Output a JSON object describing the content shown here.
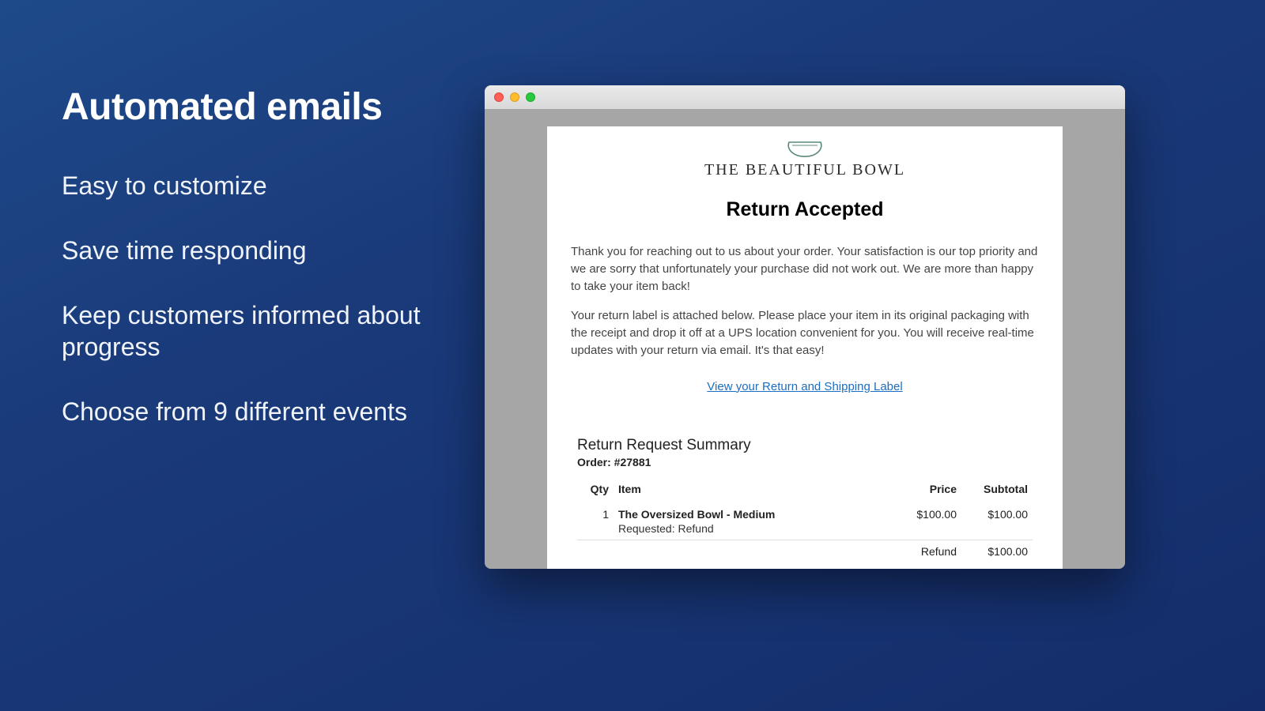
{
  "marketing": {
    "heading": "Automated emails",
    "bullets": [
      "Easy to customize",
      "Save time responding",
      "Keep customers informed about progress",
      "Choose from 9 different events"
    ]
  },
  "email": {
    "brand_name": "THE BEAUTIFUL BOWL",
    "title": "Return Accepted",
    "paragraph1": "Thank you for reaching out to us about your order. Your satisfaction is our top priority and we are sorry that unfortunately your purchase did not work out. We are more than happy to take your item back!",
    "paragraph2": "Your return label is attached below. Please place your item in its original packaging with the receipt and drop it off at a UPS location convenient for you. You will receive real-time updates with your return via email. It's that easy!",
    "link_text": "View your Return and Shipping Label",
    "summary": {
      "title": "Return Request Summary",
      "order_label": "Order: #27881",
      "columns": {
        "qty": "Qty",
        "item": "Item",
        "price": "Price",
        "subtotal": "Subtotal"
      },
      "line": {
        "qty": "1",
        "name": "The Oversized Bowl - Medium",
        "requested": "Requested: Refund",
        "price": "$100.00",
        "subtotal": "$100.00"
      },
      "totals": {
        "label": "Refund",
        "amount": "$100.00"
      }
    }
  }
}
